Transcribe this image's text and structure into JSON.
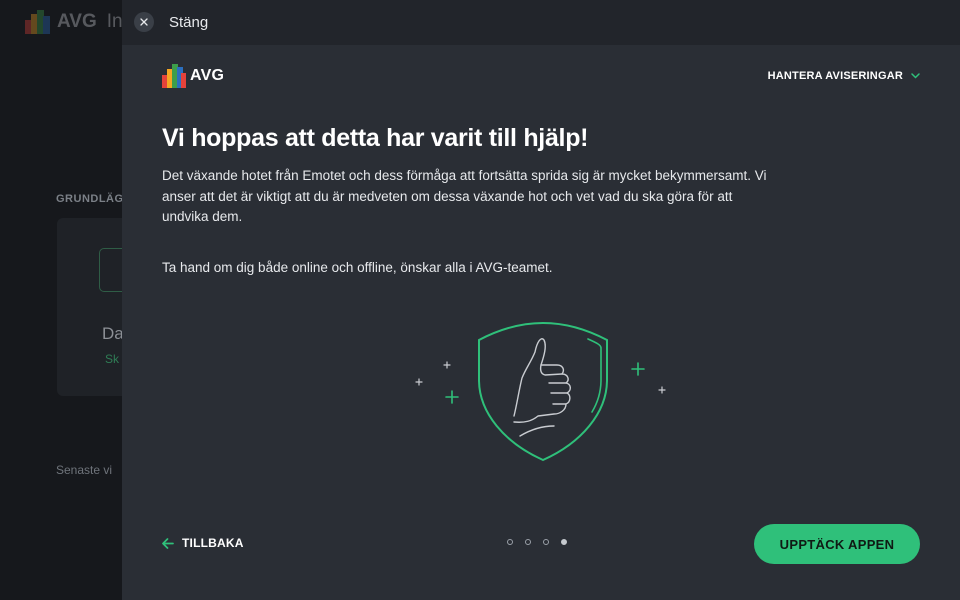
{
  "background_app": {
    "logo_text": "AVG",
    "app_name_partial": "Int",
    "section_partial": "GRUNDLÄG",
    "card_title_partial": "Da",
    "card_sub_partial": "Sk",
    "recent_partial": "Senaste vi"
  },
  "modal": {
    "close_label": "Stäng",
    "logo_text": "AVG",
    "notifications_label": "HANTERA AVISERINGAR",
    "title": "Vi hoppas att detta har varit till hjälp!",
    "body_paragraph_1": "Det växande hotet från Emotet och dess förmåga att fortsätta sprida sig är mycket bekymmersamt. Vi anser att det är viktigt att du är medveten om dessa växande hot och vet vad du ska göra för att undvika dem.",
    "body_paragraph_2": "Ta hand om dig både online och offline, önskar alla i AVG-teamet.",
    "back_label": "TILLBAKA",
    "cta_label": "UPPTÄCK APPEN",
    "pagination": {
      "total": 4,
      "active": 4
    }
  },
  "colors": {
    "accent_green": "#2fc07a",
    "panel_bg": "#2a2e35",
    "topbar_bg": "#22252b"
  },
  "icons": [
    "avg-logo-icon",
    "close-icon",
    "chevron-down-icon",
    "arrow-left-icon",
    "shield-thumbs-up-icon"
  ]
}
